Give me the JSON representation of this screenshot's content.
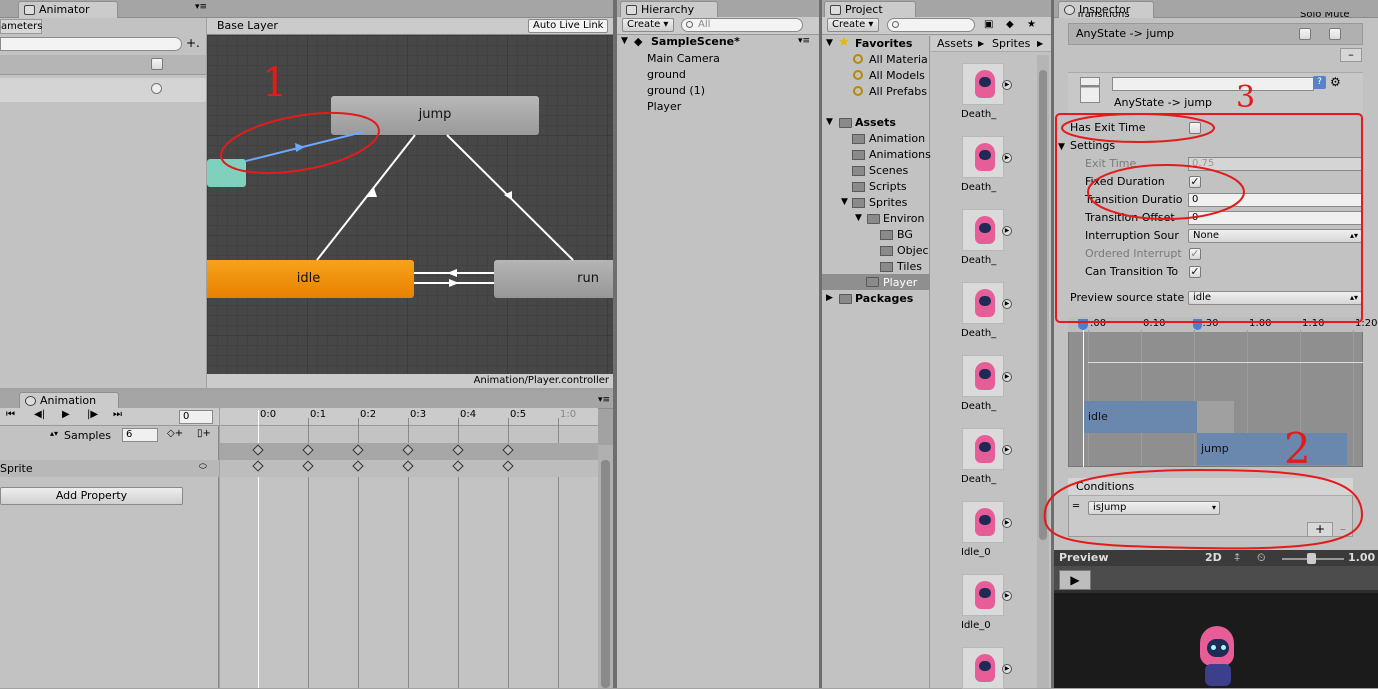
{
  "animator": {
    "tab_label": "Animator",
    "params_label": "ameters",
    "base_layer": "Base Layer",
    "auto_live_link": "Auto Live Link",
    "footer_path": "Animation/Player.controller",
    "nodes": {
      "jump": "jump",
      "idle": "idle",
      "run": "run"
    }
  },
  "animation": {
    "tab_label": "Animation",
    "frame": "0",
    "samples_label": "Samples",
    "samples_value": "6",
    "track_label": "Sprite",
    "add_property": "Add Property",
    "ruler": [
      "0:0",
      "0:1",
      "0:2",
      "0:3",
      "0:4",
      "0:5",
      "1:0"
    ]
  },
  "hierarchy": {
    "tab_label": "Hierarchy",
    "create": "Create",
    "search_placeholder": "All",
    "scene": "SampleScene*",
    "items": [
      "Main Camera",
      "ground",
      "ground (1)",
      "Player"
    ]
  },
  "project": {
    "tab_label": "Project",
    "create": "Create",
    "favorites": "Favorites",
    "fav_items": [
      "All Materia",
      "All Models",
      "All Prefabs"
    ],
    "assets": "Assets",
    "asset_folders": [
      "Animation",
      "Animations",
      "Scenes",
      "Scripts",
      "Sprites"
    ],
    "environ": "Environ",
    "environ_children": [
      "BG",
      "Objec",
      "Tiles"
    ],
    "player": "Player",
    "packages": "Packages",
    "breadcrumb": [
      "Assets",
      "Sprites"
    ],
    "files": [
      "Death_",
      "Death_",
      "Death_",
      "Death_",
      "Death_",
      "Death_",
      "Idle_0",
      "Idle_0",
      ""
    ]
  },
  "inspector": {
    "tab_label": "Inspector",
    "transitions_header": "Transitions",
    "solo_mute": "Solo Mute",
    "transition_row": "AnyState -> jump",
    "transition_title": "AnyState -> jump",
    "has_exit_time": "Has Exit Time",
    "settings": "Settings",
    "exit_time_label": "Exit Time",
    "exit_time_value": "0.75",
    "fixed_duration": "Fixed Duration",
    "transition_duration_label": "Transition Duratio",
    "transition_duration_value": "0",
    "transition_offset_label": "Transition Offset",
    "transition_offset_value": "0",
    "interruption_label": "Interruption Sour",
    "interruption_value": "None",
    "ordered_label": "Ordered Interrupt",
    "can_transition_label": "Can Transition To",
    "preview_source_label": "Preview source state",
    "preview_source_value": "idle",
    "timeline_ticks": [
      ":00",
      "0:10",
      "0:30",
      "1:00",
      "1:10",
      "1:20"
    ],
    "timeline_idle": "idle",
    "timeline_jump": "jump",
    "conditions": "Conditions",
    "condition_param": "isJump",
    "preview_label": "Preview",
    "preview_2d": "2D",
    "preview_speed": "1.00"
  },
  "annotations": {
    "one": "1",
    "two": "2",
    "three": "3"
  },
  "colors": {
    "idle_node": "#f08a00",
    "entry_node": "#7fd1be",
    "red_ink": "#e31b1b",
    "selected": "#3d6fb8"
  }
}
